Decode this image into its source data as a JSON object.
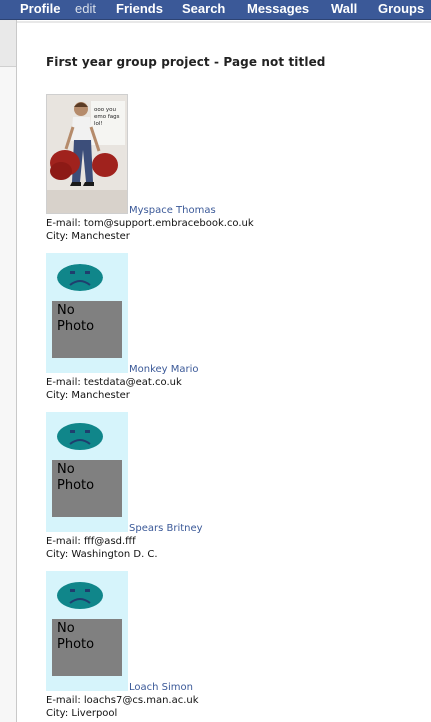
{
  "nav": {
    "profile": "Profile",
    "edit": "edit",
    "friends": "Friends",
    "search": "Search",
    "messages": "Messages",
    "wall": "Wall",
    "groups": "Groups"
  },
  "page_title": "First year group project - Page not titled",
  "no_photo_label_line1": "No",
  "no_photo_label_line2": "Photo",
  "photo_caption_lines": [
    "ooo you",
    "emo fags",
    "lol!"
  ],
  "members": [
    {
      "name": "Myspace Thomas",
      "email": "E-mail: tom@support.embracebook.co.uk",
      "city": "City: Manchester"
    },
    {
      "name": "Monkey Mario",
      "email": "E-mail: testdata@eat.co.uk",
      "city": "City: Manchester"
    },
    {
      "name": "Spears Britney",
      "email": "E-mail: fff@asd.fff",
      "city": "City: Washington D. C."
    },
    {
      "name": "Loach Simon",
      "email": "E-mail: loachs7@cs.man.ac.uk",
      "city": "City: Liverpool"
    }
  ],
  "colors": {
    "topbar": "#3b5998",
    "link": "#3b5998",
    "no_photo_bg": "#d6f4fb",
    "sad_face": "#10868a",
    "no_photo_box": "#808080"
  }
}
